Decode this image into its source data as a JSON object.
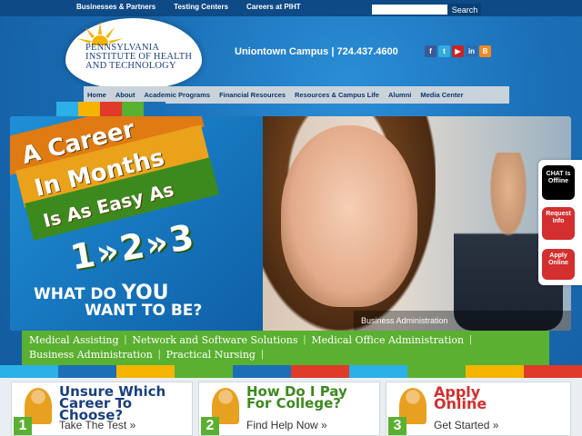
{
  "toplinks": [
    "Businesses & Partners",
    "Testing Centers",
    "Careers at PIHT"
  ],
  "search": {
    "placeholder": "",
    "button": "Search"
  },
  "logo": {
    "line1": "PENNSYLVANIA",
    "line2": "INSTITUTE OF HEALTH",
    "line3": "AND TECHNOLOGY"
  },
  "campus": "Uniontown Campus | 724.437.4600",
  "social": [
    {
      "icon": "facebook-icon",
      "glyph": "f",
      "color": "#3b5998"
    },
    {
      "icon": "twitter-icon",
      "glyph": "t",
      "color": "#33aadd"
    },
    {
      "icon": "youtube-icon",
      "glyph": "▶",
      "color": "#cc2222"
    },
    {
      "icon": "linkedin-icon",
      "glyph": "in",
      "color": "#2a6db0"
    },
    {
      "icon": "blog-icon",
      "glyph": "B",
      "color": "#f08a24"
    }
  ],
  "nav": [
    "Home",
    "About",
    "Academic Programs",
    "Financial Resources",
    "Resources & Campus Life",
    "Alumni",
    "Media Center"
  ],
  "hero": {
    "line1": "A Career",
    "line2": "In Months",
    "line3": "Is As Easy As",
    "steps": "1»2»3",
    "what1": "WHAT DO",
    "what_you": "YOU",
    "what2": "WANT TO BE?",
    "caption": "Business Administration"
  },
  "side": {
    "chat": "CHAT Is Offline",
    "request": "Request Info",
    "apply": "Apply Online"
  },
  "programs": {
    "row1": [
      "Medical Assisting",
      "Network and Software Solutions",
      "Medical Office Administration"
    ],
    "row2": [
      "Business Administration",
      "Practical Nursing"
    ]
  },
  "cards": [
    {
      "num": "1",
      "title": "Unsure Which Career To Choose?",
      "action": "Take The Test »",
      "color": "#1a3f80"
    },
    {
      "num": "2",
      "title": "How Do I Pay For College?",
      "action": "Find Help Now »",
      "color": "#3c8a1e"
    },
    {
      "num": "3",
      "title": "Apply Online",
      "action": "Get Started »",
      "color": "#d32f2f"
    }
  ],
  "colors": {
    "stripes": [
      "#2bb0e8",
      "#f5b400",
      "#e03a2a",
      "#5ab030",
      "#1b6fb7"
    ],
    "bar": [
      "#2bb0e8",
      "#1b6fb7",
      "#f5b400",
      "#5ab030",
      "#1b6fb7",
      "#e03a2a",
      "#2bb0e8",
      "#5ab030",
      "#f5b400",
      "#e03a2a"
    ]
  }
}
